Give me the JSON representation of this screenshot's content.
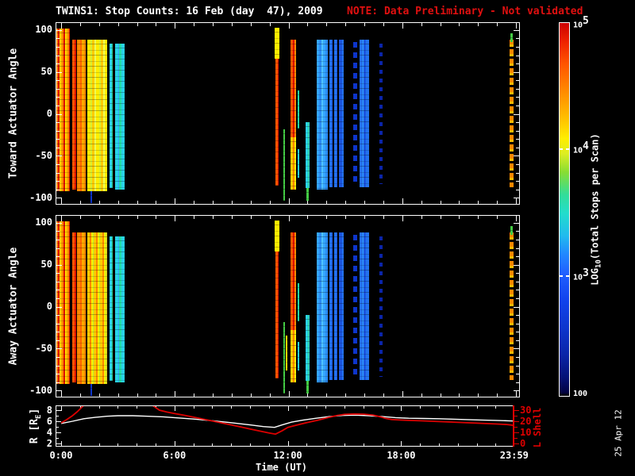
{
  "header": {
    "title": "TWINS1: Stop Counts: 16 Feb (day  47), 2009",
    "note": "NOTE: Data Preliminary - Not validated",
    "note_color": "#e01010"
  },
  "footer": {
    "date_stamp": "25 Apr 12"
  },
  "palette": {
    "red": "#e01000",
    "orange": "#ff8800",
    "amber": "#ffbb00",
    "yellow": "#ffee00",
    "green": "#44cc44",
    "teal": "#22ddaa",
    "cyan": "#29d3e8",
    "lblue": "#35a6ff",
    "blue": "#2472ee",
    "dblue": "#0d35cc",
    "mixwarm": "repeating-linear-gradient(90deg,#ff8800 0 2px,#e01000 2px 4px,#ffee00 4px 5px,#ffbb00 5px 7px)",
    "orangemix": "repeating-linear-gradient(90deg,#ff8800 0 4px,#ff6600 4px 6px,#ffaa00 6px 9px)",
    "orangeredmix": "repeating-linear-gradient(90deg,#ff5500 0 3px,#e01000 3px 5px,#ff8800 5px 7px)",
    "yellowmix": "repeating-linear-gradient(90deg,#ffee00 0 4px,#d8ee33 4px 6px,#ffcc00 6px 9px,#eeff55 9px 11px)",
    "warmmix2": "repeating-linear-gradient(90deg,#ffcc00 0 3px,#ff8800 3px 5px,#ffee00 5px 7px,#bbee33 7px 8px)",
    "cyanmix": "repeating-linear-gradient(90deg,#29d3e8 0 3px,#33cc88 3px 4px,#29d3e8 4px 7px,#55ddcc 7px 9px)",
    "cyanmix2": "repeating-linear-gradient(90deg,#29d3e8 0 4px,#35a6ff 4px 5px,#22ddaa 5px 8px)",
    "lbluemix": "repeating-linear-gradient(90deg,#35a6ff 0 3px,#2b8cf5 3px 6px,#4fc3ff 6px 8px)",
    "bluemix": "repeating-linear-gradient(90deg,#2472ee 0 3px,#1b55e0 3px 5px,#35a6ff 5px 6px)",
    "mbluemix": "repeating-linear-gradient(90deg,#1b55e0 0 4px,#2472ee 4px 6px,#0d35cc 6px 8px)",
    "bluemix2": "repeating-linear-gradient(90deg,#2472ee 0 4px,#35a6ff 4px 5px,#1b55e0 5px 8px)",
    "dbluebroken": "repeating-linear-gradient(180deg,#0d35cc 0 7px,transparent 7px 13px)",
    "navybroken": "repeating-linear-gradient(180deg,#0a24a8 0 5px,transparent 5px 11px)",
    "orangebroken": "repeating-linear-gradient(180deg,#ff8800 0 6px,#ffbb00 6px 9px,transparent 9px 12px)"
  },
  "chart_data": {
    "type": "heatmap",
    "time_axis": {
      "label": "Time (UT)",
      "tick_labels": [
        "0:00",
        "6:00",
        "12:00",
        "18:00",
        "23:59"
      ],
      "tick_hours": [
        0,
        6,
        12,
        18,
        23.983
      ],
      "minor_tick_every_hours": 1,
      "range_hours": [
        0,
        24
      ]
    },
    "value_colorbar": {
      "label": "LOG_{10}(Total Stops per Scan)",
      "tick_labels": [
        "10^5",
        "10^4",
        "10^3",
        "100"
      ],
      "tick_fracs": [
        0,
        0.337,
        0.676,
        1
      ],
      "dash_fracs": [
        0.337,
        0.676
      ],
      "gradient_stops": [
        [
          "#cc0000",
          0
        ],
        [
          "#ee2200",
          5
        ],
        [
          "#ff5500",
          11
        ],
        [
          "#ff8800",
          18
        ],
        [
          "#ffbb00",
          25
        ],
        [
          "#ffee00",
          31
        ],
        [
          "#ddee22",
          35
        ],
        [
          "#88dd33",
          40
        ],
        [
          "#33dd99",
          46
        ],
        [
          "#22ddcc",
          51
        ],
        [
          "#22bbee",
          57
        ],
        [
          "#2288ff",
          62
        ],
        [
          "#2161ff",
          67
        ],
        [
          "#1144ee",
          74
        ],
        [
          "#0d35cc",
          82
        ],
        [
          "#0a24a8",
          89
        ],
        [
          "#041177",
          95
        ],
        [
          "#020344",
          99
        ],
        [
          "#000000",
          100
        ]
      ]
    },
    "panels": [
      {
        "name": "toward",
        "ylabel": "Toward Actuator Angle",
        "ylim": [
          -100,
          100
        ],
        "yticks": [
          100,
          50,
          0,
          -50,
          -100
        ],
        "minor_ytick_every": 10,
        "stripes": [
          [
            -0.25,
            0.45,
            102,
            -92,
            "mixwarm"
          ],
          [
            0.58,
            0.82,
            88,
            -90,
            "orangeredmix"
          ],
          [
            0.82,
            1.32,
            88,
            -92,
            "orangemix"
          ],
          [
            1.4,
            2.45,
            88,
            -92,
            "yellowmix"
          ],
          [
            1.55,
            1.64,
            -92,
            -106,
            "dblue"
          ],
          [
            2.55,
            2.74,
            84,
            -88,
            "cyanmix"
          ],
          [
            2.86,
            3.36,
            84,
            -90,
            "cyanmix2"
          ],
          [
            11.27,
            11.52,
            103,
            66,
            "yellow"
          ],
          [
            11.3,
            11.48,
            66,
            -86,
            "orangeredmix"
          ],
          [
            11.72,
            11.79,
            -18,
            -104,
            "green"
          ],
          [
            12.1,
            12.42,
            88,
            -28,
            "orangeredmix"
          ],
          [
            12.1,
            12.42,
            -28,
            -90,
            "warmmix2"
          ],
          [
            12.46,
            12.56,
            28,
            -18,
            "teal"
          ],
          [
            12.46,
            12.56,
            -42,
            -76,
            "cyan"
          ],
          [
            12.9,
            13.11,
            -10,
            -88,
            "cyanmix"
          ],
          [
            12.95,
            13.06,
            -88,
            -104,
            "green"
          ],
          [
            13.49,
            14.08,
            88,
            -90,
            "lbluemix"
          ],
          [
            14.15,
            14.33,
            88,
            -88,
            "bluemix"
          ],
          [
            14.4,
            14.58,
            88,
            -88,
            "bluemix"
          ],
          [
            14.66,
            14.92,
            88,
            -88,
            "mbluemix"
          ],
          [
            15.41,
            15.63,
            86,
            -86,
            "dbluebroken"
          ],
          [
            15.75,
            16.26,
            88,
            -88,
            "bluemix2"
          ],
          [
            16.79,
            16.97,
            84,
            -84,
            "navybroken"
          ],
          [
            23.66,
            23.88,
            88,
            -88,
            "orangebroken"
          ],
          [
            23.7,
            23.82,
            96,
            86,
            "green"
          ]
        ]
      },
      {
        "name": "away",
        "ylabel": "Away Actuator Angle",
        "ylim": [
          -100,
          100
        ],
        "yticks": [
          100,
          50,
          0,
          -50,
          -100
        ],
        "minor_ytick_every": 10,
        "stripes": [
          [
            -0.25,
            0.45,
            102,
            -92,
            "mixwarm"
          ],
          [
            0.58,
            0.82,
            88,
            -90,
            "orangeredmix"
          ],
          [
            0.82,
            1.32,
            88,
            -92,
            "orangemix"
          ],
          [
            1.4,
            2.45,
            88,
            -92,
            "warmmix2"
          ],
          [
            1.55,
            1.64,
            -92,
            -106,
            "dblue"
          ],
          [
            2.55,
            2.74,
            84,
            -88,
            "cyanmix"
          ],
          [
            2.86,
            3.36,
            84,
            -90,
            "cyanmix2"
          ],
          [
            11.27,
            11.52,
            103,
            66,
            "yellow"
          ],
          [
            11.3,
            11.48,
            66,
            -86,
            "orangeredmix"
          ],
          [
            11.72,
            11.79,
            -18,
            -104,
            "green"
          ],
          [
            11.85,
            11.96,
            -34,
            -76,
            "yellow"
          ],
          [
            12.1,
            12.42,
            88,
            -28,
            "orangeredmix"
          ],
          [
            12.1,
            12.42,
            -28,
            -90,
            "warmmix2"
          ],
          [
            12.46,
            12.56,
            28,
            -18,
            "teal"
          ],
          [
            12.46,
            12.56,
            -42,
            -76,
            "cyan"
          ],
          [
            12.9,
            13.11,
            -10,
            -88,
            "cyanmix"
          ],
          [
            12.95,
            13.06,
            -88,
            -104,
            "green"
          ],
          [
            13.49,
            14.08,
            88,
            -90,
            "lbluemix"
          ],
          [
            14.15,
            14.33,
            88,
            -88,
            "bluemix"
          ],
          [
            14.4,
            14.58,
            88,
            -88,
            "bluemix"
          ],
          [
            14.66,
            14.92,
            88,
            -88,
            "mbluemix"
          ],
          [
            15.41,
            15.63,
            86,
            -86,
            "dbluebroken"
          ],
          [
            15.75,
            16.26,
            88,
            -88,
            "bluemix2"
          ],
          [
            16.79,
            16.97,
            84,
            -84,
            "navybroken"
          ],
          [
            23.66,
            23.88,
            88,
            -88,
            "orangebroken"
          ],
          [
            23.7,
            23.82,
            96,
            86,
            "green"
          ]
        ]
      }
    ],
    "bottom_panel": {
      "left_label": "R [R_{E}]",
      "left_ticks": [
        8,
        6,
        4,
        2
      ],
      "left_range": [
        2,
        8
      ],
      "right_label": "L Shell",
      "right_ticks": [
        30,
        20,
        10,
        0
      ],
      "right_range": [
        0,
        30
      ],
      "line_colors": {
        "r": "#ffffff",
        "l": "#dd0000"
      },
      "r_series": [
        [
          0,
          5.6
        ],
        [
          0.6,
          6.0
        ],
        [
          1.2,
          6.45
        ],
        [
          1.8,
          6.7
        ],
        [
          2.4,
          6.9
        ],
        [
          3.0,
          7.0
        ],
        [
          3.8,
          7.0
        ],
        [
          4.6,
          6.9
        ],
        [
          5.4,
          6.8
        ],
        [
          6.2,
          6.6
        ],
        [
          7,
          6.4
        ],
        [
          8,
          6.1
        ],
        [
          9,
          5.75
        ],
        [
          10,
          5.35
        ],
        [
          10.7,
          5.05
        ],
        [
          11.3,
          4.9
        ],
        [
          11.7,
          5.35
        ],
        [
          12.2,
          5.85
        ],
        [
          12.8,
          6.2
        ],
        [
          13.5,
          6.55
        ],
        [
          14.2,
          6.85
        ],
        [
          14.9,
          7.05
        ],
        [
          15.6,
          7.1
        ],
        [
          16.3,
          7.0
        ],
        [
          17,
          6.85
        ],
        [
          17.7,
          6.65
        ],
        [
          18.4,
          6.55
        ],
        [
          19.2,
          6.5
        ],
        [
          20,
          6.45
        ],
        [
          21,
          6.35
        ],
        [
          22,
          6.25
        ],
        [
          23,
          6.15
        ],
        [
          24,
          6.05
        ]
      ],
      "l_series_segments": [
        [
          [
            0,
            18.5
          ],
          [
            0.3,
            21.5
          ],
          [
            0.6,
            25
          ],
          [
            0.85,
            28.5
          ],
          [
            1.3,
            36
          ]
        ],
        [
          [
            4.7,
            36
          ],
          [
            5.2,
            30
          ],
          [
            5.6,
            28.3
          ],
          [
            6,
            27
          ],
          [
            6.5,
            25.4
          ],
          [
            7,
            23.7
          ],
          [
            7.5,
            22
          ],
          [
            8,
            20.3
          ],
          [
            8.5,
            18.5
          ],
          [
            9,
            16.7
          ],
          [
            9.5,
            14.9
          ],
          [
            10,
            13
          ],
          [
            10.5,
            11.2
          ],
          [
            11,
            9.4
          ],
          [
            11.35,
            8.4
          ],
          [
            11.7,
            11.5
          ],
          [
            12,
            14.5
          ],
          [
            12.4,
            16.3
          ],
          [
            13,
            18.8
          ],
          [
            13.6,
            21
          ],
          [
            14.1,
            23.2
          ],
          [
            14.6,
            25.2
          ],
          [
            15,
            26.2
          ],
          [
            15.5,
            26.6
          ],
          [
            16,
            26.4
          ],
          [
            16.5,
            25.6
          ],
          [
            16.9,
            24
          ],
          [
            17.2,
            22.5
          ],
          [
            17.5,
            21.6
          ],
          [
            18,
            21.1
          ],
          [
            19,
            20.4
          ],
          [
            20,
            19.7
          ],
          [
            21,
            19
          ],
          [
            22,
            18.3
          ],
          [
            23,
            17.6
          ],
          [
            23.6,
            17.1
          ],
          [
            23.85,
            16.6
          ],
          [
            24,
            15.8
          ]
        ]
      ]
    }
  }
}
